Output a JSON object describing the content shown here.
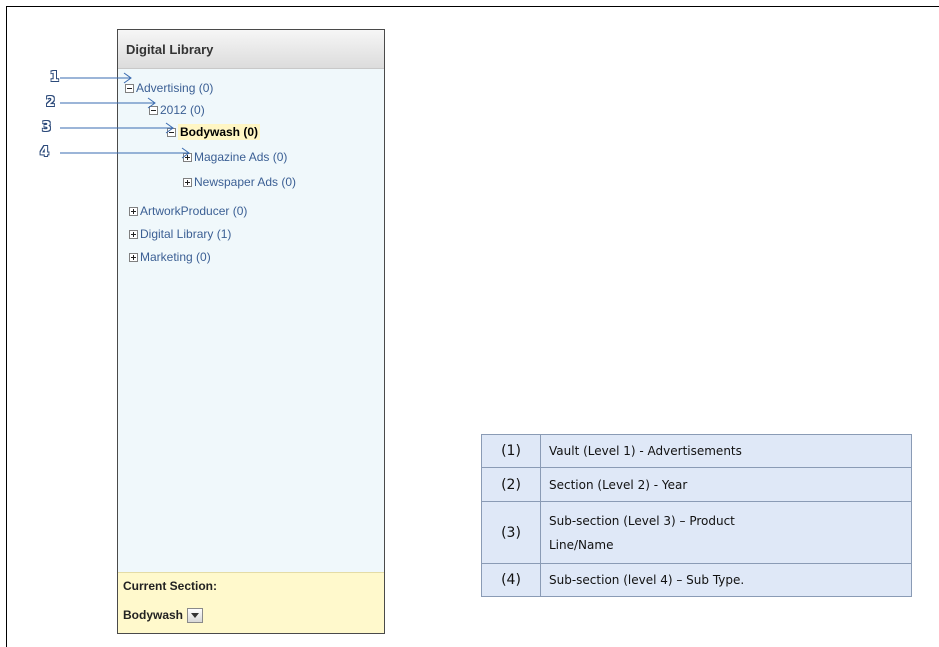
{
  "panel": {
    "title": "Digital Library",
    "tree": [
      {
        "label": "Advertising (0)",
        "toggle": "minus",
        "selected": false
      },
      {
        "label": "2012 (0)",
        "toggle": "minus",
        "selected": false
      },
      {
        "label": "Bodywash (0)",
        "toggle": "minus",
        "selected": true
      },
      {
        "label": "Magazine Ads (0)",
        "toggle": "plus",
        "selected": false
      },
      {
        "label": "Newspaper Ads (0)",
        "toggle": "plus",
        "selected": false
      },
      {
        "label": "ArtworkProducer (0)",
        "toggle": "plus",
        "selected": false
      },
      {
        "label": "Digital Library (1)",
        "toggle": "plus",
        "selected": false
      },
      {
        "label": "Marketing (0)",
        "toggle": "plus",
        "selected": false
      }
    ],
    "current_section_label": "Current Section:",
    "current_section_value": "Bodywash"
  },
  "callouts": [
    "1",
    "2",
    "3",
    "4"
  ],
  "legend": [
    {
      "num": "(1)",
      "desc": "Vault (Level 1) - Advertisements"
    },
    {
      "num": "(2)",
      "desc": "Section (Level 2) - Year"
    },
    {
      "num": "(3)",
      "desc_line1": "Sub-section (Level 3) – Product",
      "desc_line2": "Line/Name"
    },
    {
      "num": "(4)",
      "desc": "Sub-section (level 4) – Sub Type."
    }
  ],
  "colors": {
    "arrow": "#3a6bb0",
    "link": "#3b5f94",
    "panel_bg": "#f0f8fb",
    "current_bg": "#fff9cc",
    "legend_bg": "#dfe8f7"
  }
}
